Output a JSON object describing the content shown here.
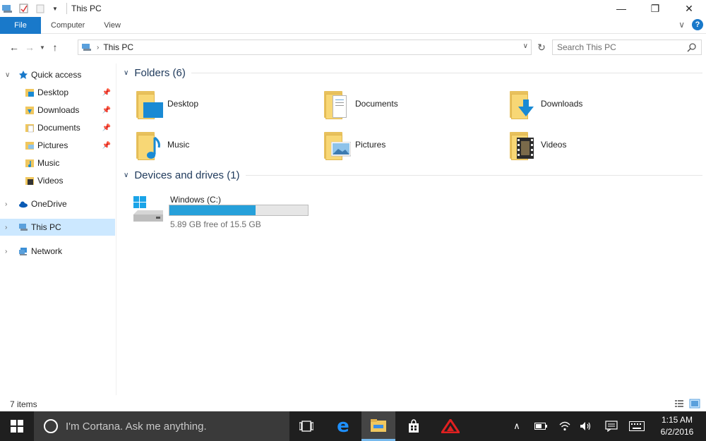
{
  "window": {
    "title": "This PC",
    "minimize_glyph": "—",
    "maximize_glyph": "❐",
    "close_glyph": "✕"
  },
  "ribbon": {
    "tabs": [
      "File",
      "Computer",
      "View"
    ],
    "expand_glyph": "∨",
    "help_glyph": "?"
  },
  "address": {
    "path": "This PC",
    "search_placeholder": "Search This PC"
  },
  "nav": {
    "quick_access": "Quick access",
    "quick_items": [
      {
        "label": "Desktop",
        "pinned": true
      },
      {
        "label": "Downloads",
        "pinned": true
      },
      {
        "label": "Documents",
        "pinned": true
      },
      {
        "label": "Pictures",
        "pinned": true
      },
      {
        "label": "Music",
        "pinned": false
      },
      {
        "label": "Videos",
        "pinned": false
      }
    ],
    "onedrive": "OneDrive",
    "this_pc": "This PC",
    "network": "Network"
  },
  "folders": {
    "header": "Folders (6)",
    "items": [
      "Desktop",
      "Documents",
      "Downloads",
      "Music",
      "Pictures",
      "Videos"
    ]
  },
  "devices": {
    "header": "Devices and drives (1)",
    "drive_name": "Windows (C:)",
    "drive_free": "5.89 GB free of 15.5 GB",
    "used_fraction": 0.62
  },
  "status": {
    "item_count": "7 items"
  },
  "taskbar": {
    "cortana_placeholder": "I'm Cortana. Ask me anything.",
    "time": "1:15 AM",
    "date": "6/2/2016"
  },
  "colors": {
    "accent": "#1979ca",
    "selection": "#cce8ff",
    "drive_fill": "#26a0da",
    "folder": "#f8d775",
    "taskbar": "#1f1f1f"
  }
}
